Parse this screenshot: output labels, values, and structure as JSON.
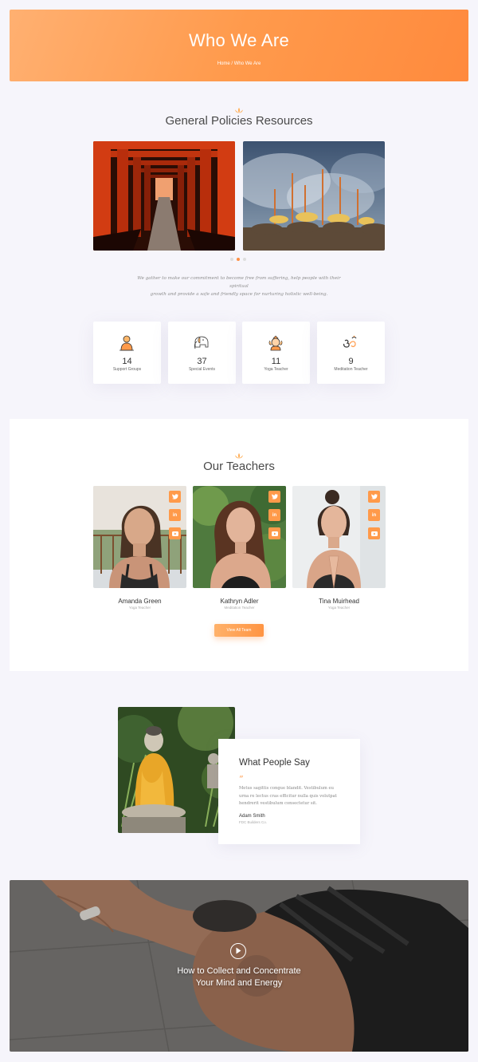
{
  "hero": {
    "title": "Who We Are",
    "breadcrumb": "Home / Who We Are"
  },
  "resources": {
    "title": "General Policies Resources",
    "intro_line1": "We gather to make our commitment to become free from suffering, help people with their spiritual",
    "intro_line2": "growth and provide a safe and friendly space for nurturing holistic well-being."
  },
  "stats": [
    {
      "value": "14",
      "label": "Support Groups",
      "icon": "meditating-monk-icon"
    },
    {
      "value": "37",
      "label": "Special Events",
      "icon": "elephant-icon"
    },
    {
      "value": "11",
      "label": "Yoga Teacher",
      "icon": "ganesha-icon"
    },
    {
      "value": "9",
      "label": "Meditation Teacher",
      "icon": "om-symbol-icon"
    }
  ],
  "teachers": {
    "title": "Our Teachers",
    "members": [
      {
        "name": "Amanda Green",
        "role": "Yoga Teacher"
      },
      {
        "name": "Kathryn Adler",
        "role": "Meditation Teacher"
      },
      {
        "name": "Tina Muirhead",
        "role": "Yoga Teacher"
      }
    ],
    "button": "View All Team"
  },
  "testimonial": {
    "title": "What People Say",
    "quote_line1": "Metus sagittis congue blandit. Vestibulum eu",
    "quote_line2": "urna re lectus cras efficitur nulla quis volutpat",
    "quote_line3": "hendrerit vestibulum consectetur sit.",
    "author": "Adam Smith",
    "company": "FDC Builders Co."
  },
  "video": {
    "line1": "How to Collect and Concentrate",
    "line2": "Your Mind and Energy"
  },
  "colors": {
    "accent": "#ff9a4a",
    "background": "#f6f5fb"
  }
}
